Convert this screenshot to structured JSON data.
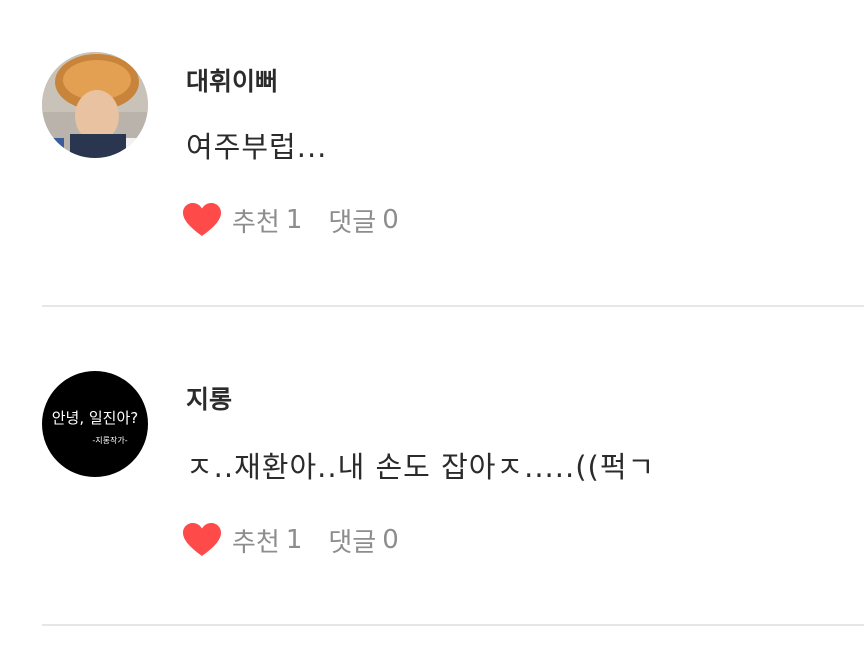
{
  "colors": {
    "heart": "#ff4a4a",
    "text": "#2b2b2b",
    "muted": "#8d8d8d",
    "divider": "#e6e6e6"
  },
  "comments": [
    {
      "username": "대휘이뻐",
      "text": "여주부럽...",
      "like_label": "추천",
      "like_count": "1",
      "reply_label": "댓글",
      "reply_count": "0",
      "avatar_icon": "profile-photo-icon"
    },
    {
      "username": "지롱",
      "text": "ㅈ..재환아..내 손도 잡아ㅈ.....((퍽ㄱ",
      "like_label": "추천",
      "like_count": "1",
      "reply_label": "댓글",
      "reply_count": "0",
      "avatar_icon": "text-logo-avatar-icon",
      "avatar_text": "안녕, 일진아?",
      "avatar_subtext": "-지롱작가-"
    }
  ]
}
